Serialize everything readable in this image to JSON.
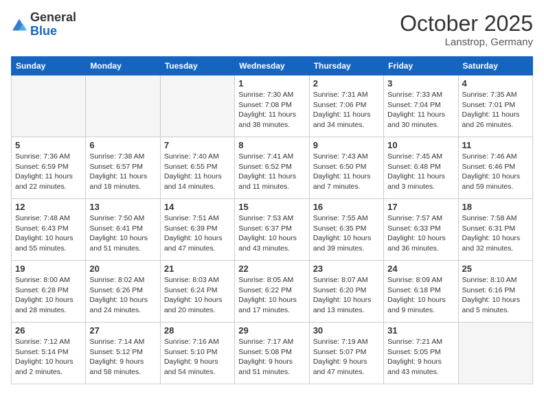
{
  "header": {
    "logo_general": "General",
    "logo_blue": "Blue",
    "month": "October 2025",
    "location": "Lanstrop, Germany"
  },
  "weekdays": [
    "Sunday",
    "Monday",
    "Tuesday",
    "Wednesday",
    "Thursday",
    "Friday",
    "Saturday"
  ],
  "weeks": [
    [
      {
        "day": "",
        "empty": true
      },
      {
        "day": "",
        "empty": true
      },
      {
        "day": "",
        "empty": true
      },
      {
        "day": "1",
        "sunrise": "Sunrise: 7:30 AM",
        "sunset": "Sunset: 7:08 PM",
        "daylight": "Daylight: 11 hours and 38 minutes."
      },
      {
        "day": "2",
        "sunrise": "Sunrise: 7:31 AM",
        "sunset": "Sunset: 7:06 PM",
        "daylight": "Daylight: 11 hours and 34 minutes."
      },
      {
        "day": "3",
        "sunrise": "Sunrise: 7:33 AM",
        "sunset": "Sunset: 7:04 PM",
        "daylight": "Daylight: 11 hours and 30 minutes."
      },
      {
        "day": "4",
        "sunrise": "Sunrise: 7:35 AM",
        "sunset": "Sunset: 7:01 PM",
        "daylight": "Daylight: 11 hours and 26 minutes."
      }
    ],
    [
      {
        "day": "5",
        "sunrise": "Sunrise: 7:36 AM",
        "sunset": "Sunset: 6:59 PM",
        "daylight": "Daylight: 11 hours and 22 minutes."
      },
      {
        "day": "6",
        "sunrise": "Sunrise: 7:38 AM",
        "sunset": "Sunset: 6:57 PM",
        "daylight": "Daylight: 11 hours and 18 minutes."
      },
      {
        "day": "7",
        "sunrise": "Sunrise: 7:40 AM",
        "sunset": "Sunset: 6:55 PM",
        "daylight": "Daylight: 11 hours and 14 minutes."
      },
      {
        "day": "8",
        "sunrise": "Sunrise: 7:41 AM",
        "sunset": "Sunset: 6:52 PM",
        "daylight": "Daylight: 11 hours and 11 minutes."
      },
      {
        "day": "9",
        "sunrise": "Sunrise: 7:43 AM",
        "sunset": "Sunset: 6:50 PM",
        "daylight": "Daylight: 11 hours and 7 minutes."
      },
      {
        "day": "10",
        "sunrise": "Sunrise: 7:45 AM",
        "sunset": "Sunset: 6:48 PM",
        "daylight": "Daylight: 11 hours and 3 minutes."
      },
      {
        "day": "11",
        "sunrise": "Sunrise: 7:46 AM",
        "sunset": "Sunset: 6:46 PM",
        "daylight": "Daylight: 10 hours and 59 minutes."
      }
    ],
    [
      {
        "day": "12",
        "sunrise": "Sunrise: 7:48 AM",
        "sunset": "Sunset: 6:43 PM",
        "daylight": "Daylight: 10 hours and 55 minutes."
      },
      {
        "day": "13",
        "sunrise": "Sunrise: 7:50 AM",
        "sunset": "Sunset: 6:41 PM",
        "daylight": "Daylight: 10 hours and 51 minutes."
      },
      {
        "day": "14",
        "sunrise": "Sunrise: 7:51 AM",
        "sunset": "Sunset: 6:39 PM",
        "daylight": "Daylight: 10 hours and 47 minutes."
      },
      {
        "day": "15",
        "sunrise": "Sunrise: 7:53 AM",
        "sunset": "Sunset: 6:37 PM",
        "daylight": "Daylight: 10 hours and 43 minutes."
      },
      {
        "day": "16",
        "sunrise": "Sunrise: 7:55 AM",
        "sunset": "Sunset: 6:35 PM",
        "daylight": "Daylight: 10 hours and 39 minutes."
      },
      {
        "day": "17",
        "sunrise": "Sunrise: 7:57 AM",
        "sunset": "Sunset: 6:33 PM",
        "daylight": "Daylight: 10 hours and 36 minutes."
      },
      {
        "day": "18",
        "sunrise": "Sunrise: 7:58 AM",
        "sunset": "Sunset: 6:31 PM",
        "daylight": "Daylight: 10 hours and 32 minutes."
      }
    ],
    [
      {
        "day": "19",
        "sunrise": "Sunrise: 8:00 AM",
        "sunset": "Sunset: 6:28 PM",
        "daylight": "Daylight: 10 hours and 28 minutes."
      },
      {
        "day": "20",
        "sunrise": "Sunrise: 8:02 AM",
        "sunset": "Sunset: 6:26 PM",
        "daylight": "Daylight: 10 hours and 24 minutes."
      },
      {
        "day": "21",
        "sunrise": "Sunrise: 8:03 AM",
        "sunset": "Sunset: 6:24 PM",
        "daylight": "Daylight: 10 hours and 20 minutes."
      },
      {
        "day": "22",
        "sunrise": "Sunrise: 8:05 AM",
        "sunset": "Sunset: 6:22 PM",
        "daylight": "Daylight: 10 hours and 17 minutes."
      },
      {
        "day": "23",
        "sunrise": "Sunrise: 8:07 AM",
        "sunset": "Sunset: 6:20 PM",
        "daylight": "Daylight: 10 hours and 13 minutes."
      },
      {
        "day": "24",
        "sunrise": "Sunrise: 8:09 AM",
        "sunset": "Sunset: 6:18 PM",
        "daylight": "Daylight: 10 hours and 9 minutes."
      },
      {
        "day": "25",
        "sunrise": "Sunrise: 8:10 AM",
        "sunset": "Sunset: 6:16 PM",
        "daylight": "Daylight: 10 hours and 5 minutes."
      }
    ],
    [
      {
        "day": "26",
        "sunrise": "Sunrise: 7:12 AM",
        "sunset": "Sunset: 5:14 PM",
        "daylight": "Daylight: 10 hours and 2 minutes."
      },
      {
        "day": "27",
        "sunrise": "Sunrise: 7:14 AM",
        "sunset": "Sunset: 5:12 PM",
        "daylight": "Daylight: 9 hours and 58 minutes."
      },
      {
        "day": "28",
        "sunrise": "Sunrise: 7:16 AM",
        "sunset": "Sunset: 5:10 PM",
        "daylight": "Daylight: 9 hours and 54 minutes."
      },
      {
        "day": "29",
        "sunrise": "Sunrise: 7:17 AM",
        "sunset": "Sunset: 5:08 PM",
        "daylight": "Daylight: 9 hours and 51 minutes."
      },
      {
        "day": "30",
        "sunrise": "Sunrise: 7:19 AM",
        "sunset": "Sunset: 5:07 PM",
        "daylight": "Daylight: 9 hours and 47 minutes."
      },
      {
        "day": "31",
        "sunrise": "Sunrise: 7:21 AM",
        "sunset": "Sunset: 5:05 PM",
        "daylight": "Daylight: 9 hours and 43 minutes."
      },
      {
        "day": "",
        "empty": true
      }
    ]
  ]
}
